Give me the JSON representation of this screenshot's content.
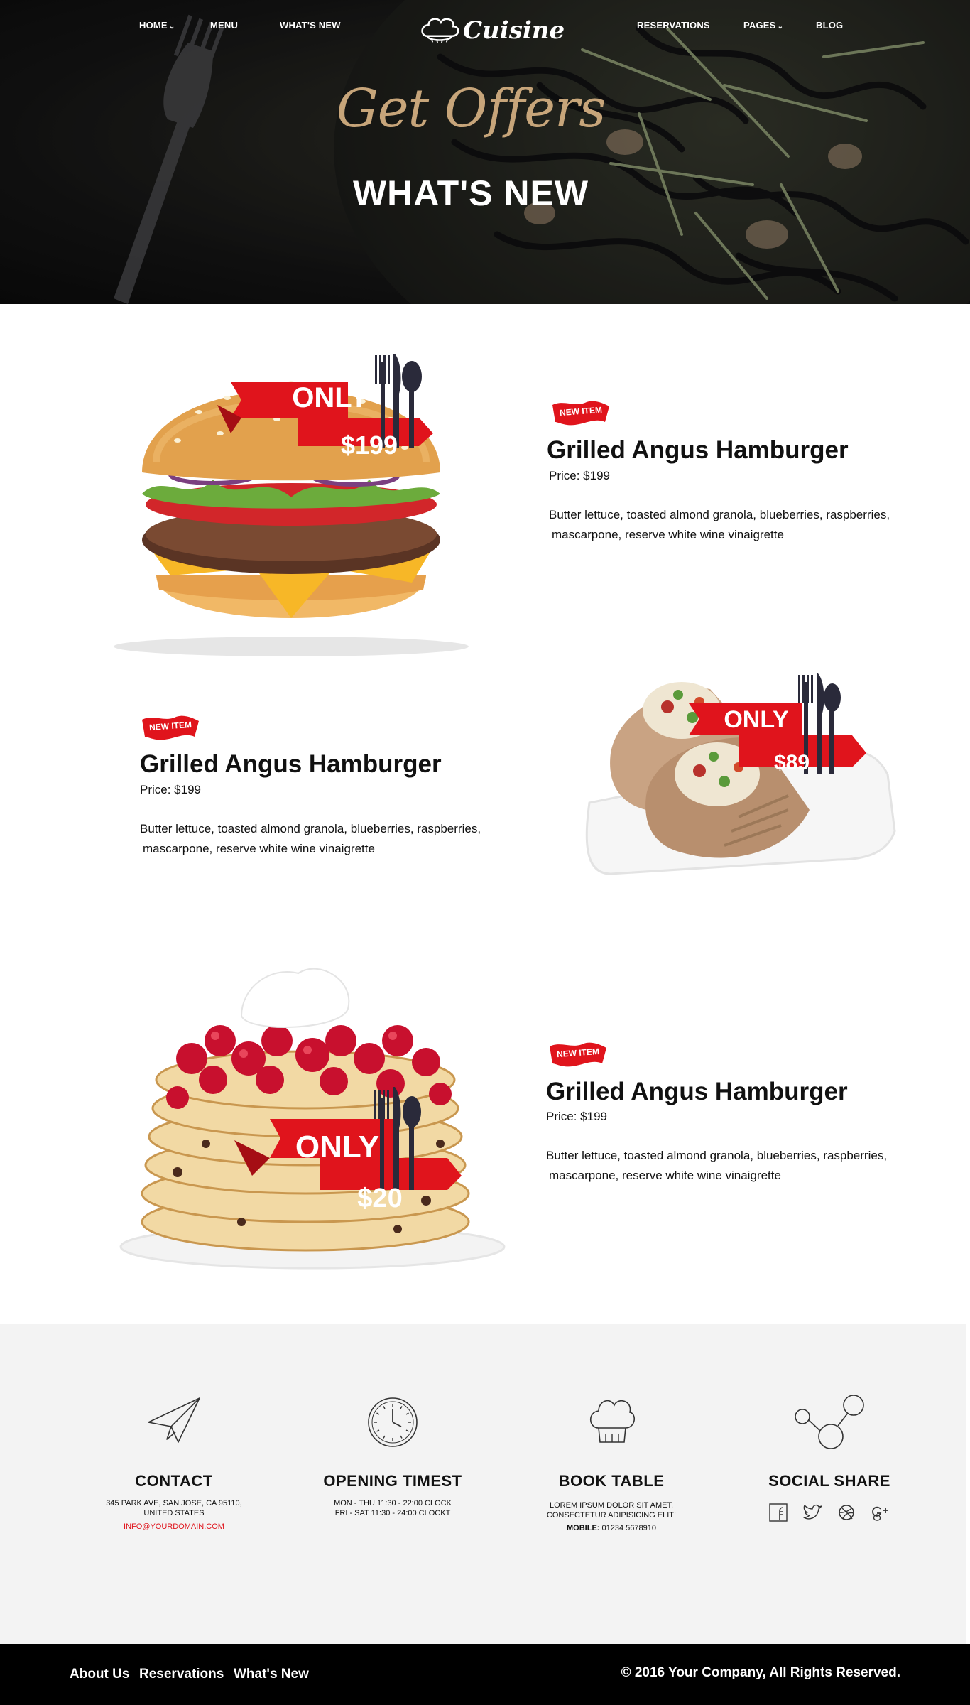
{
  "nav": {
    "home": "HOME",
    "menu": "MENU",
    "whats_new": "WHAT'S NEW",
    "reservations": "RESERVATIONS",
    "pages": "PAGES",
    "blog": "BLOG",
    "logo_text": "Cuisine"
  },
  "hero": {
    "script": "Get Offers",
    "title": "WHAT'S NEW"
  },
  "items": [
    {
      "badge": "NEW ITEM",
      "title": "Grilled Angus Hamburger",
      "price": "Price: $199",
      "desc_line1": "Butter lettuce, toasted almond granola, blueberries, raspberries,",
      "desc_line2": "mascarpone, reserve white wine vinaigrette",
      "promo_only": "ONLY",
      "promo_price": "$199",
      "image": "hamburger"
    },
    {
      "badge": "NEW ITEM",
      "title": "Grilled Angus Hamburger",
      "price": "Price: $199",
      "desc_line1": "Butter lettuce, toasted almond granola, blueberries, raspberries,",
      "desc_line2": "mascarpone, reserve white wine vinaigrette",
      "promo_only": "ONLY",
      "promo_price": "$89",
      "image": "wrap"
    },
    {
      "badge": "NEW ITEM",
      "title": "Grilled Angus Hamburger",
      "price": "Price: $199",
      "desc_line1": "Butter lettuce, toasted almond granola, blueberries, raspberries,",
      "desc_line2": "mascarpone, reserve white wine vinaigrette",
      "promo_only": "ONLY",
      "promo_price": "$20",
      "image": "pancakes"
    }
  ],
  "info": {
    "contact": {
      "title": "CONTACT",
      "line1": "345 PARK AVE, SAN JOSE, CA 95110,",
      "line2": "UNITED STATES",
      "email": "INFO@YOURDOMAIN.COM",
      "icon": "paper-plane-icon"
    },
    "hours": {
      "title": "OPENING TIMEST",
      "line1": "MON - THU 11:30 - 22:00 CLOCK",
      "line2": "FRI - SAT 11:30 - 24:00 CLOCKT",
      "icon": "clock-icon"
    },
    "book": {
      "title": "BOOK TABLE",
      "line1": "LOREM IPSUM DOLOR SIT AMET,",
      "line2": "CONSECTETUR ADIPISICING ELIT!",
      "mobile_label": "MOBILE:",
      "mobile_number": "01234 5678910",
      "icon": "chef-hat-icon"
    },
    "social": {
      "title": "SOCIAL SHARE",
      "icons": [
        "facebook-icon",
        "twitter-icon",
        "dribbble-icon",
        "google-plus-icon"
      ],
      "icon": "share-icon"
    }
  },
  "footer": {
    "about": "About Us",
    "reservations": "Reservations",
    "whats_new": "What's New",
    "copyright": "©  2016  Your Company, All Rights Reserved."
  },
  "colors": {
    "accent_red": "#e0141c",
    "gold_script": "#c7a57a",
    "info_bg": "#f3f3f3"
  }
}
